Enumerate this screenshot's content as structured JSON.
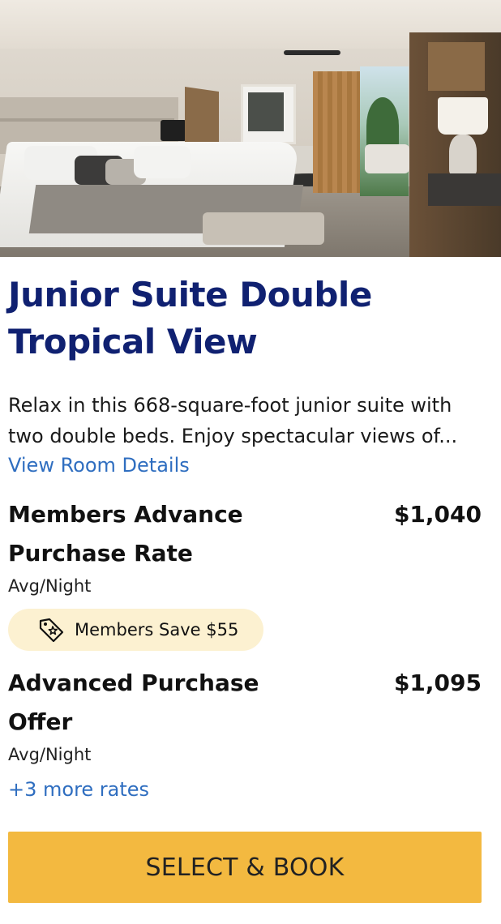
{
  "room": {
    "title": "Junior Suite Double Tropical View",
    "description_line1": "Relax in this 668-square-foot junior suite with",
    "description_line2": "two double beds. Enjoy spectacular views of...",
    "details_link": "View Room Details"
  },
  "rates": [
    {
      "name": "Members Advance Purchase Rate",
      "price": "$1,040",
      "unit": "Avg/Night",
      "badge": "Members Save $55"
    },
    {
      "name": "Advanced Purchase Offer",
      "price": "$1,095",
      "unit": "Avg/Night"
    }
  ],
  "more_rates_link": "+3 more rates",
  "cta": {
    "label": "SELECT & BOOK"
  },
  "icons": {
    "photo": "room-photo",
    "badge": "tag-star-icon"
  },
  "colors": {
    "title": "#102171",
    "link": "#2f6ec0",
    "badge_bg": "#fcf1d1",
    "cta_bg": "#f3b940"
  }
}
